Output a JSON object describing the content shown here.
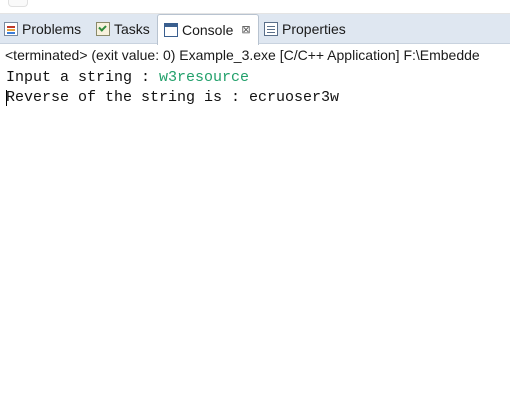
{
  "tabs": [
    {
      "label": "Problems",
      "icon": "problems-icon"
    },
    {
      "label": "Tasks",
      "icon": "tasks-icon"
    },
    {
      "label": "Console",
      "icon": "console-icon",
      "active": true,
      "close": "⊠"
    },
    {
      "label": "Properties",
      "icon": "properties-icon"
    }
  ],
  "status": "<terminated> (exit value: 0) Example_3.exe [C/C++ Application] F:\\Embedde",
  "console": {
    "line1_prompt": "Input a string : ",
    "line1_input": "w3resource",
    "line2": "Reverse of the string is : ecruoser3w"
  },
  "colors": {
    "input_text": "#22a06b",
    "tab_bar": "#dfe7f1"
  }
}
